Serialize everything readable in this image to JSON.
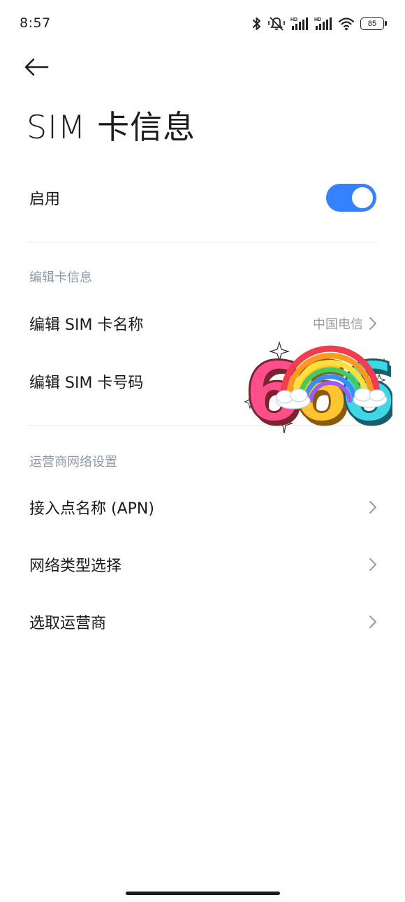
{
  "status_bar": {
    "time": "8:57",
    "icons": [
      "bluetooth-icon",
      "mute-vibrate-icon",
      "hd-signal-icon",
      "hd-signal-icon",
      "wifi-icon",
      "battery-icon"
    ],
    "battery_level": "85"
  },
  "header": {
    "back_icon": "arrow-left-icon",
    "title": "SIM 卡信息"
  },
  "enable_row": {
    "label": "启用",
    "enabled": true,
    "accent_color": "#3482ff"
  },
  "section_edit": {
    "header": "编辑卡信息",
    "items": [
      {
        "label": "编辑 SIM 卡名称",
        "value": "中国电信"
      },
      {
        "label": "编辑 SIM 卡号码",
        "value": ""
      }
    ]
  },
  "section_network": {
    "header": "运营商网络设置",
    "items": [
      {
        "label": "接入点名称 (APN)"
      },
      {
        "label": "网络类型选择"
      },
      {
        "label": "选取运营商"
      }
    ]
  },
  "sticker": {
    "text": "666"
  },
  "colors": {
    "section_header": "#8e99ad",
    "secondary_text": "#9a9a9a",
    "divider": "#e6e6e6"
  }
}
